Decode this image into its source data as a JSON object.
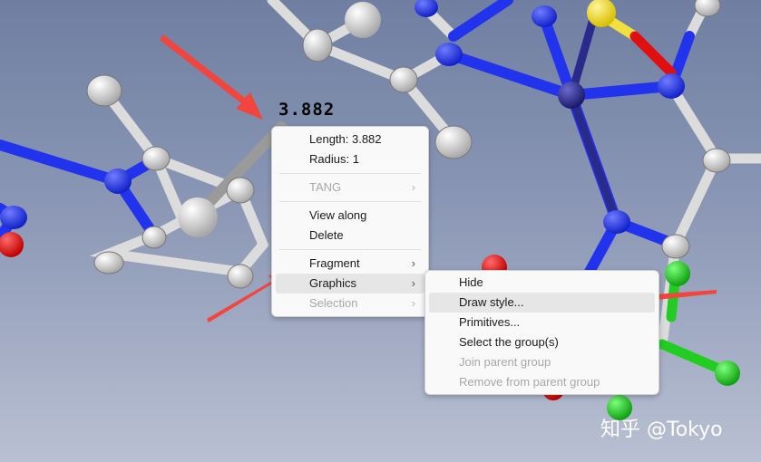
{
  "viewer": {
    "distance_label": "3.882"
  },
  "context_menu": {
    "items": [
      {
        "label": "Length: 3.882",
        "enabled": true
      },
      {
        "label": "Radius: 1",
        "enabled": true
      },
      {
        "label": "TANG",
        "enabled": false,
        "submenu": true
      },
      {
        "label": "View along",
        "enabled": true
      },
      {
        "label": "Delete",
        "enabled": true
      },
      {
        "label": "Fragment",
        "enabled": true,
        "submenu": true
      },
      {
        "label": "Graphics",
        "enabled": true,
        "submenu": true,
        "highlighted": true
      },
      {
        "label": "Selection",
        "enabled": false,
        "submenu": true
      }
    ],
    "submenu_arrow": "›"
  },
  "graphics_submenu": {
    "items": [
      {
        "label": "Hide",
        "enabled": true
      },
      {
        "label": "Draw style...",
        "enabled": true,
        "highlighted": true
      },
      {
        "label": "Primitives...",
        "enabled": true
      },
      {
        "label": "Select the group(s)",
        "enabled": true
      },
      {
        "label": "Join parent group",
        "enabled": false
      },
      {
        "label": "Remove from parent group",
        "enabled": false
      }
    ]
  },
  "watermark": "知乎 @Tokyo",
  "colors": {
    "background_top": "#6f7fa2",
    "background_bottom": "#b9c0d3",
    "nitrogen": "#1f2fe8",
    "carbon": "#e6e6e6",
    "oxygen": "#e01010",
    "sulfur": "#f2e020",
    "chlorine": "#19c21e",
    "metal": "#2a2a8c",
    "annotation_arrow": "#f2453d"
  }
}
